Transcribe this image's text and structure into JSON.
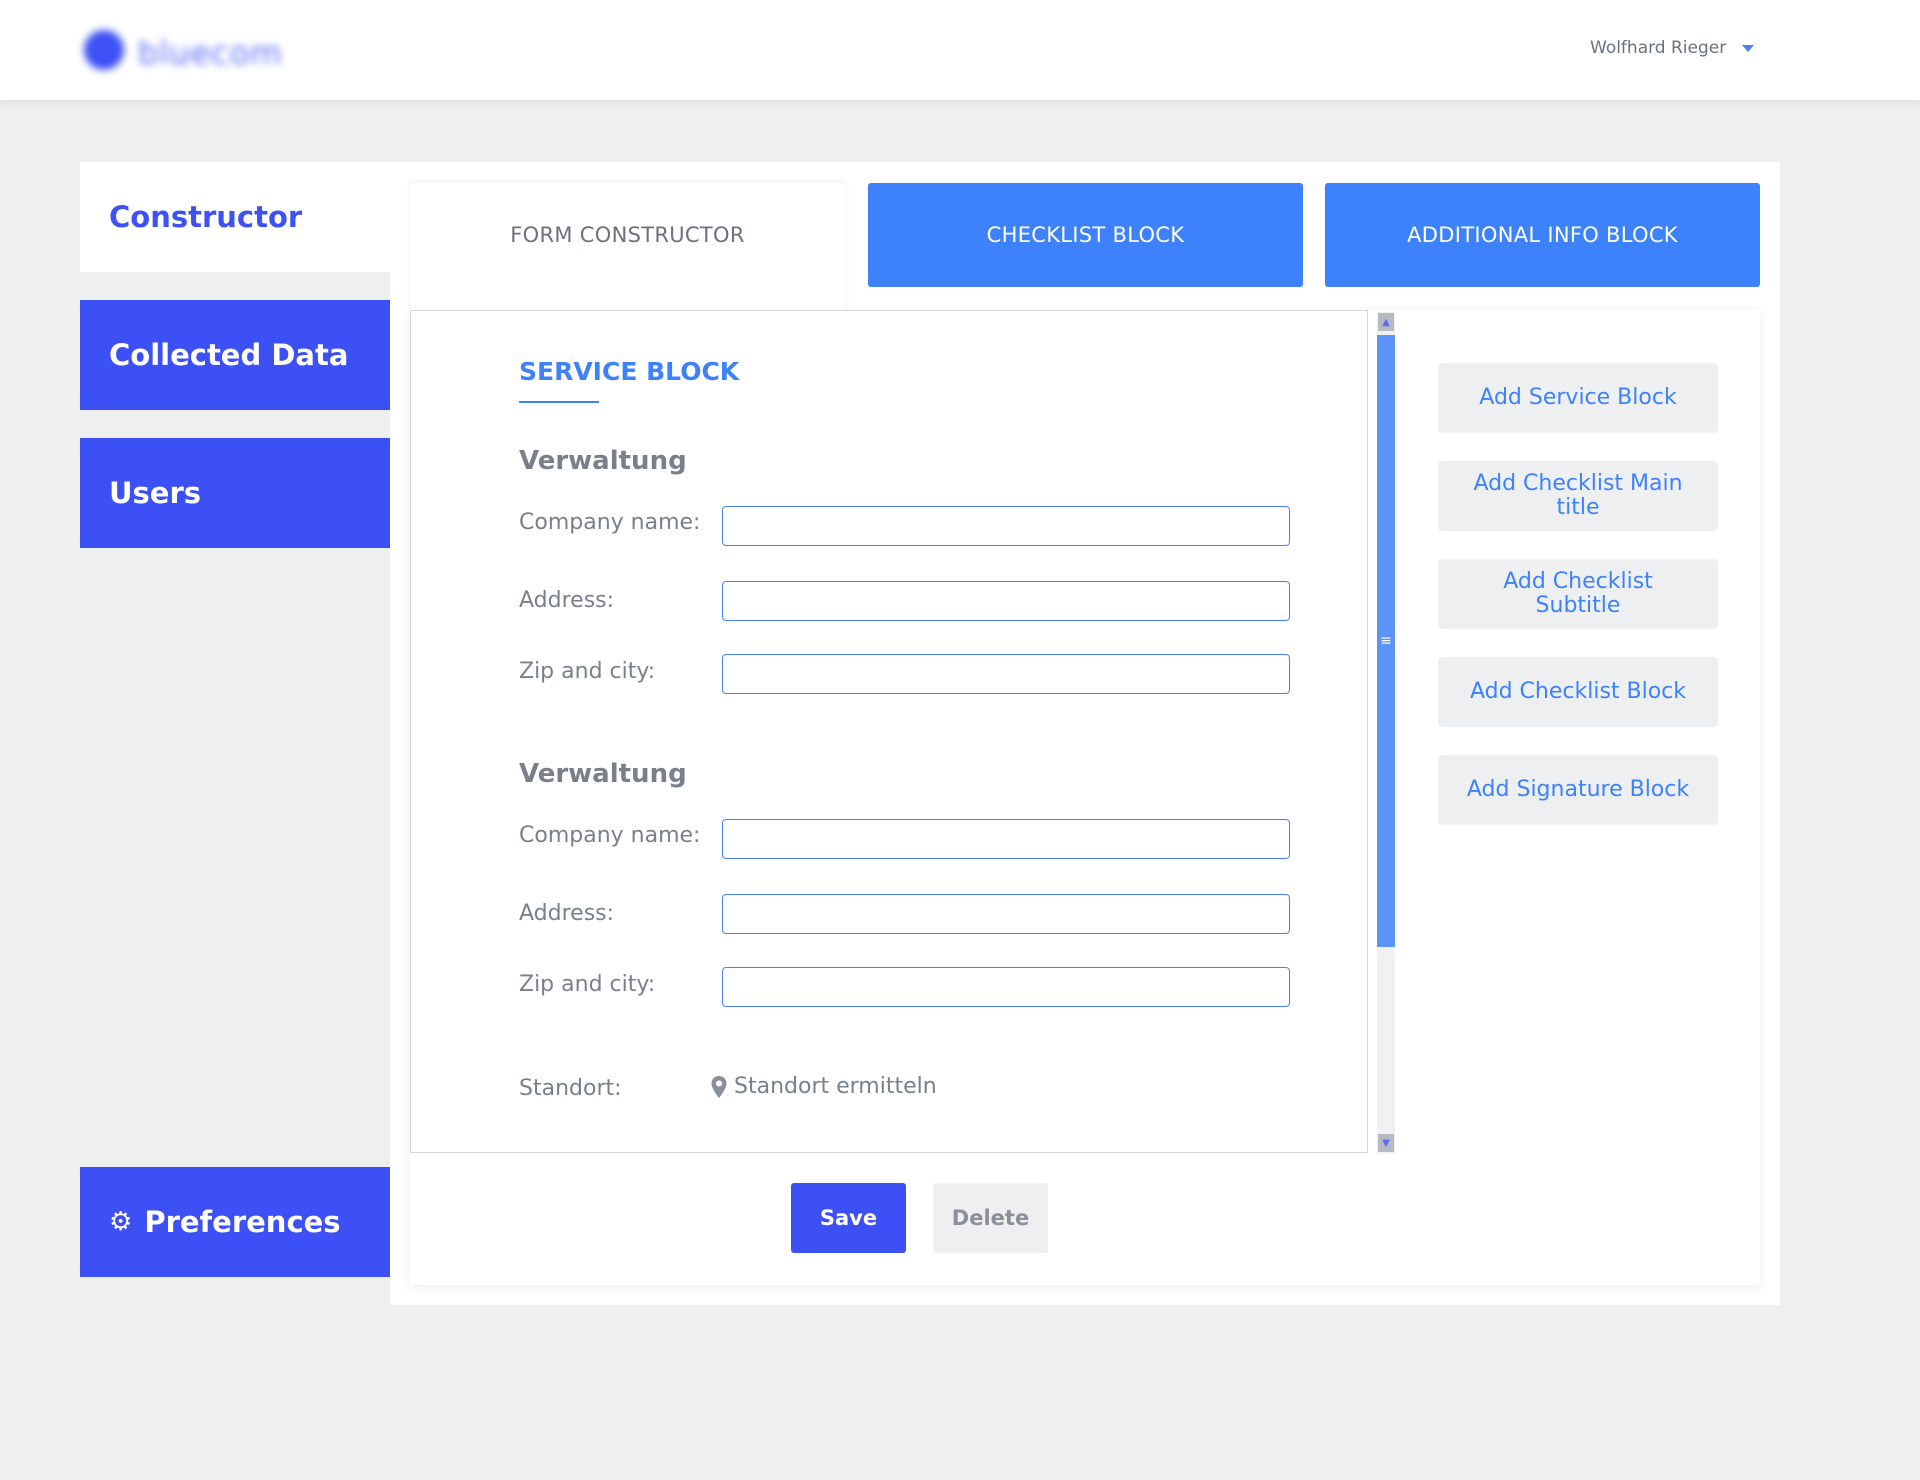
{
  "header": {
    "logo_text": "bluecom",
    "user_name": "Wolfhard Rieger"
  },
  "sidebar": {
    "items": [
      {
        "label": "Constructor"
      },
      {
        "label": "Collected Data"
      },
      {
        "label": "Users"
      }
    ],
    "preferences_label": "Preferences"
  },
  "tabs": [
    {
      "label": "FORM CONSTRUCTOR"
    },
    {
      "label": "CHECKLIST BLOCK"
    },
    {
      "label": "ADDITIONAL INFO BLOCK"
    }
  ],
  "form": {
    "section_title": "SERVICE BLOCK",
    "groups": [
      {
        "title": "Verwaltung",
        "fields": [
          {
            "label": "Company name:",
            "value": ""
          },
          {
            "label": "Address:",
            "value": ""
          },
          {
            "label": "Zip and city:",
            "value": ""
          }
        ]
      },
      {
        "title": "Verwaltung",
        "fields": [
          {
            "label": "Company name:",
            "value": ""
          },
          {
            "label": "Address:",
            "value": ""
          },
          {
            "label": "Zip and city:",
            "value": ""
          }
        ]
      }
    ],
    "location_label": "Standort:",
    "location_action": "Standort ermitteln"
  },
  "actions": [
    {
      "label": "Add Service Block"
    },
    {
      "label": "Add Checklist Main title"
    },
    {
      "label": "Add Checklist Subtitle"
    },
    {
      "label": "Add Checklist Block"
    },
    {
      "label": "Add Signature Block"
    }
  ],
  "buttons": {
    "save_label": "Save",
    "delete_label": "Delete"
  },
  "colors": {
    "primary": "#3c50f5",
    "accent": "#3d82fa",
    "background": "#eeefef"
  }
}
